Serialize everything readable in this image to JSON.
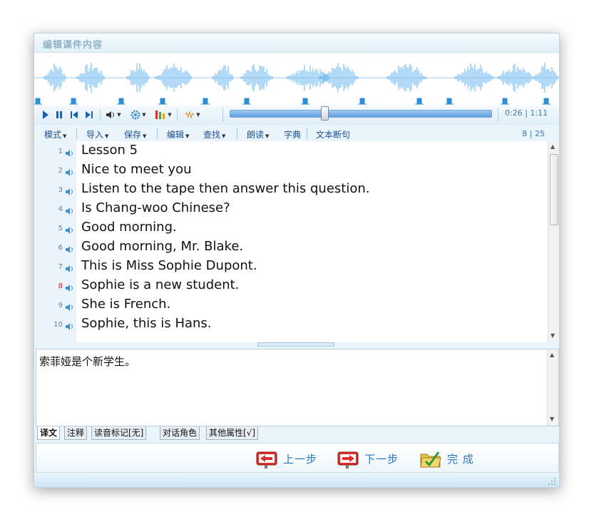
{
  "window": {
    "title": "编辑课件内容"
  },
  "player": {
    "controls": [
      "play",
      "pause",
      "previous",
      "next",
      "volume",
      "settings",
      "channel",
      "effects"
    ],
    "progress": 0.36,
    "time_current": "0:26",
    "time_separator": "|",
    "time_total": "1:11"
  },
  "menu": {
    "items": [
      {
        "label": "模式",
        "dropdown": true
      },
      {
        "label": "导入",
        "dropdown": true
      },
      {
        "label": "保存",
        "dropdown": true
      },
      {
        "label": "编辑",
        "dropdown": true
      },
      {
        "label": "查找",
        "dropdown": true
      },
      {
        "label": "朗读",
        "dropdown": true
      },
      {
        "label": "字典",
        "dropdown": false
      },
      {
        "label": "文本断句",
        "dropdown": false
      }
    ],
    "counter": "8 | 25"
  },
  "lines": [
    {
      "num": "1",
      "text": "Lesson 5"
    },
    {
      "num": "2",
      "text": "Nice to meet you"
    },
    {
      "num": "3",
      "text": "Listen to the tape then answer this question."
    },
    {
      "num": "4",
      "text": "Is Chang-woo Chinese?"
    },
    {
      "num": "5",
      "text": "Good morning."
    },
    {
      "num": "6",
      "text": "Good morning, Mr. Blake."
    },
    {
      "num": "7",
      "text": "This is Miss Sophie Dupont."
    },
    {
      "num": "8",
      "text": "Sophie is a new student."
    },
    {
      "num": "9",
      "text": "She is French."
    },
    {
      "num": "10",
      "text": "Sophie, this is Hans."
    }
  ],
  "active_line": "8",
  "translation": {
    "text": "索菲娅是个新学生。"
  },
  "tabs": [
    "译文",
    "注释",
    "读音标记[无]",
    "对话角色",
    "其他属性[√]"
  ],
  "buttons": {
    "prev_label": "上一步",
    "next_label": "下一步",
    "finish_label": "完 成"
  },
  "colors": {
    "accent": "#2a77c0",
    "waveform": "#7fc1ef",
    "marker": "#2b8fd8",
    "active_line_number": "#d02020"
  }
}
